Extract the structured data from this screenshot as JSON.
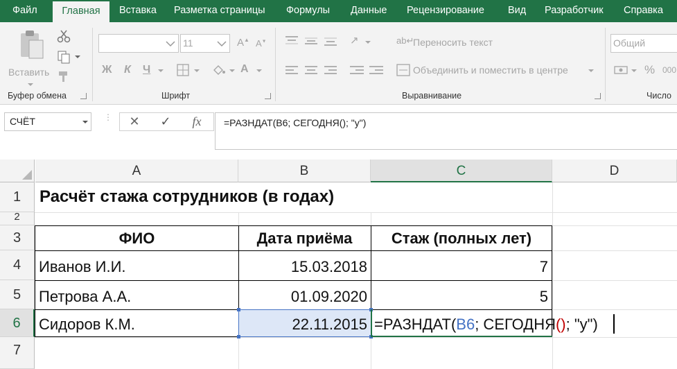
{
  "tabs": [
    "Файл",
    "Главная",
    "Вставка",
    "Разметка страницы",
    "Формулы",
    "Данные",
    "Рецензирование",
    "Вид",
    "Разработчик",
    "Справка"
  ],
  "ribbon": {
    "clipboard": {
      "label": "Буфер обмена",
      "paste_label": "Вставить"
    },
    "font": {
      "label": "Шрифт",
      "size": "11",
      "bold": "Ж",
      "italic": "К",
      "underline": "Ч"
    },
    "alignment": {
      "label": "Выравнивание",
      "wrap_text": "Переносить текст",
      "merge_center": "Объединить и поместить в центре"
    },
    "number": {
      "label": "Число",
      "format": "Общий",
      "percent": "%",
      "thousands": "000"
    }
  },
  "formula_bar": {
    "name_box": "СЧЁТ",
    "cancel_glyph": "✕",
    "enter_glyph": "✓",
    "fx_glyph": "fx",
    "formula": "=РАЗНДАТ(B6; СЕГОДНЯ(); \"y\")"
  },
  "columns": [
    "A",
    "B",
    "C",
    "D"
  ],
  "rows": [
    "1",
    "2",
    "3",
    "4",
    "5",
    "6",
    "7"
  ],
  "sheet": {
    "title": "Расчёт стажа сотрудников (в годах)",
    "headers": [
      "ФИО",
      "Дата приёма",
      "Стаж (полных лет)"
    ],
    "records": [
      {
        "name": "Иванов И.И.",
        "date": "15.03.2018",
        "years": "7"
      },
      {
        "name": "Петрова А.А.",
        "date": "01.09.2020",
        "years": "5"
      },
      {
        "name": "Сидоров К.М.",
        "date": "22.11.2015",
        "years": ""
      }
    ],
    "edit_parts": {
      "p1": "=РАЗНДАТ(",
      "ref": "B6",
      "p2": "; СЕГОДНЯ",
      "paren": "()",
      "p3": "; \"y\")"
    }
  },
  "colors": {
    "brand": "#217346",
    "ref_blue": "#4472c4",
    "paren_red": "#c00000"
  }
}
